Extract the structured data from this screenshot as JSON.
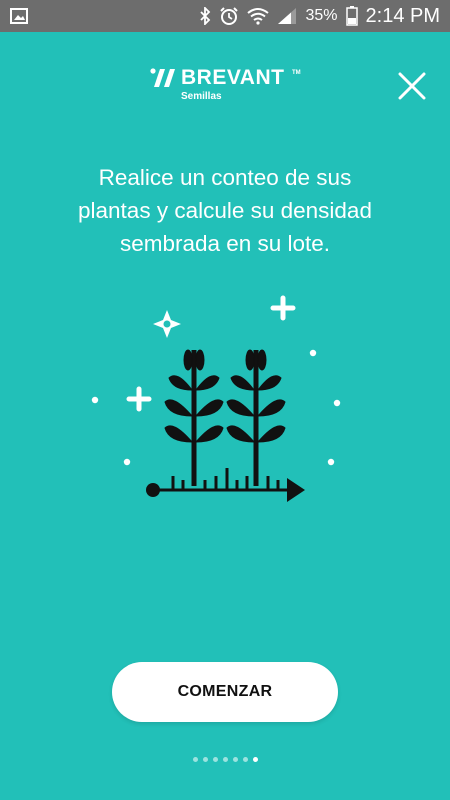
{
  "status_bar": {
    "battery": "35%",
    "time": "2:14 PM",
    "icons": [
      "gallery-icon",
      "bluetooth-icon",
      "alarm-icon",
      "wifi-icon",
      "signal-icon",
      "battery-icon"
    ]
  },
  "header": {
    "brand": "BREVANT",
    "brand_tm": "TM",
    "brand_sub": "Semillas"
  },
  "message": {
    "line1": "Realice un conteo de sus",
    "line2": "plantas y calcule su densidad",
    "line3": "sembrada en su lote."
  },
  "cta": {
    "label": "COMENZAR"
  },
  "pager": {
    "total": 7,
    "active_index": 6
  },
  "colors": {
    "background": "#22c0b8",
    "status_bar": "#6d6d6d",
    "button_bg": "#ffffff",
    "button_text": "#111111"
  }
}
